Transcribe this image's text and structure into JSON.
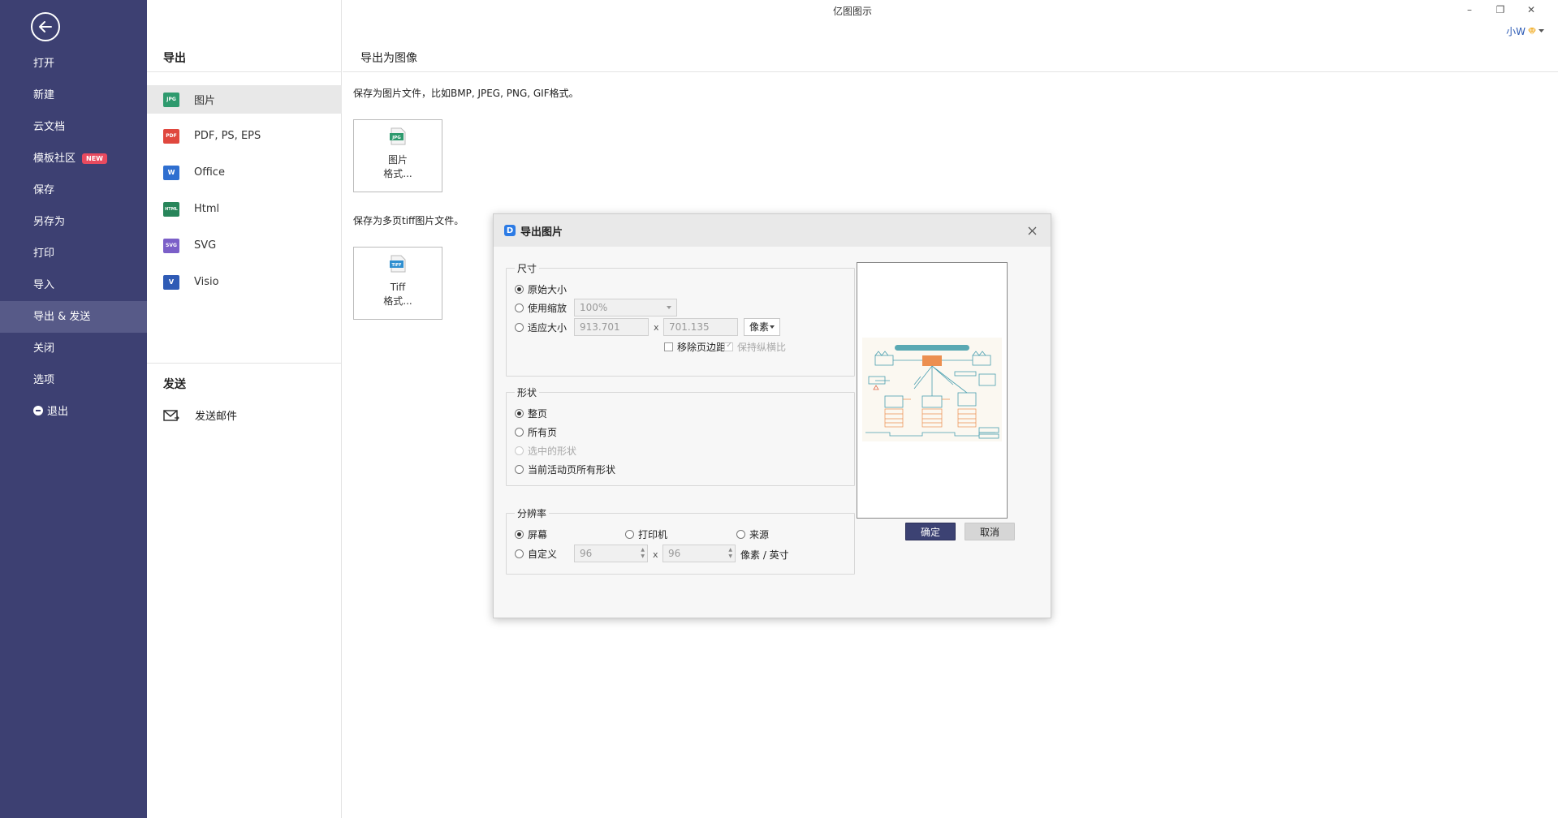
{
  "window": {
    "title": "亿图图示",
    "minimize": "–",
    "restore": "❐",
    "close": "✕"
  },
  "user": {
    "name": "小W"
  },
  "sidebar": {
    "items": [
      {
        "label": "打开"
      },
      {
        "label": "新建"
      },
      {
        "label": "云文档"
      },
      {
        "label": "模板社区",
        "badge": "NEW"
      },
      {
        "label": "保存"
      },
      {
        "label": "另存为"
      },
      {
        "label": "打印"
      },
      {
        "label": "导入"
      },
      {
        "label": "导出 & 发送",
        "active": true
      },
      {
        "label": "关闭"
      },
      {
        "label": "选项"
      },
      {
        "label": "退出"
      }
    ]
  },
  "middle": {
    "export_heading": "导出",
    "send_heading": "发送",
    "export_items": [
      {
        "label": "图片",
        "icon": "jpg-file-icon",
        "tag": "JPG",
        "color": "#2e9a6e"
      },
      {
        "label": "PDF, PS, EPS",
        "icon": "pdf-file-icon",
        "tag": "PDF",
        "color": "#e0473e"
      },
      {
        "label": "Office",
        "icon": "word-file-icon",
        "tag": "W",
        "color": "#2f6fd0"
      },
      {
        "label": "Html",
        "icon": "html-file-icon",
        "tag": "HTML",
        "color": "#27855a"
      },
      {
        "label": "SVG",
        "icon": "svg-file-icon",
        "tag": "SVG",
        "color": "#7b5fc8"
      },
      {
        "label": "Visio",
        "icon": "visio-file-icon",
        "tag": "V",
        "color": "#2f5bb5"
      }
    ],
    "send_items": [
      {
        "label": "发送邮件",
        "icon": "mail-icon"
      }
    ]
  },
  "content": {
    "heading": "导出为图像",
    "image_desc": "保存为图片文件，比如BMP, JPEG, PNG, GIF格式。",
    "image_card": {
      "line1": "图片",
      "line2": "格式...",
      "tag": "JPG"
    },
    "tiff_desc": "保存为多页tiff图片文件。",
    "tiff_card": {
      "line1": "Tiff",
      "line2": "格式...",
      "tag": "TIFF"
    }
  },
  "dialog": {
    "title": "导出图片",
    "size": {
      "label": "尺寸",
      "original": "原始大小",
      "use_zoom": "使用缩放",
      "zoom_value": "100%",
      "fit_size": "适应大小",
      "width": "913.701",
      "height": "701.135",
      "x": "x",
      "unit": "像素",
      "remove_margin": "移除页边距",
      "keep_ratio": "保持纵横比"
    },
    "shape": {
      "label": "形状",
      "whole_page": "整页",
      "all_pages": "所有页",
      "selected_shapes": "选中的形状",
      "active_page_shapes": "当前活动页所有形状"
    },
    "resolution": {
      "label": "分辨率",
      "screen": "屏幕",
      "printer": "打印机",
      "source": "来源",
      "custom": "自定义",
      "dpi_x": "96",
      "dpi_y": "96",
      "x": "x",
      "unit": "像素 / 英寸"
    },
    "ok": "确定",
    "cancel": "取消"
  }
}
